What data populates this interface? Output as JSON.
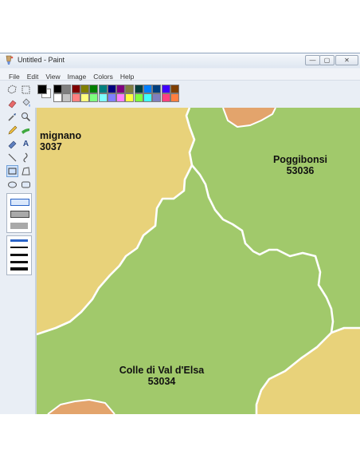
{
  "window": {
    "title": "Untitled - Paint",
    "controls": {
      "minimize": "—",
      "maximize": "▢",
      "close": "✕"
    }
  },
  "menu": {
    "items": [
      "File",
      "Edit",
      "View",
      "Image",
      "Colors",
      "Help"
    ]
  },
  "toolbox": {
    "tools": [
      "free-select-icon",
      "rect-select-icon",
      "eraser-icon",
      "fill-bucket-icon",
      "color-picker-icon",
      "magnifier-icon",
      "pencil-icon",
      "brush-icon",
      "airbrush-icon",
      "text-icon",
      "line-icon",
      "curve-icon",
      "rectangle-icon",
      "polygon-icon",
      "ellipse-icon",
      "rounded-rect-icon"
    ],
    "selected_tool": "rectangle-icon",
    "text_tool_glyph": "A"
  },
  "palette": {
    "foreground": "#000000",
    "background": "#ffffff",
    "colors": [
      "#000000",
      "#7f7f7f",
      "#7f0000",
      "#7f7f00",
      "#007f00",
      "#007f7f",
      "#00007f",
      "#7f007f",
      "#7f7f3f",
      "#003f3f",
      "#007fff",
      "#003f7f",
      "#3f00ff",
      "#7f3f00",
      "#ffffff",
      "#c3c3c3",
      "#ff7f7f",
      "#ffff7f",
      "#7fff7f",
      "#7fffff",
      "#7f7fff",
      "#ff7fff",
      "#ffff3f",
      "#7fff3f",
      "#3fffff",
      "#7f7fbf",
      "#ff3f7f",
      "#ff7f3f"
    ]
  },
  "map": {
    "colors": {
      "green": "#a1c96b",
      "yellow": "#e8d27a",
      "orange": "#e3a46c",
      "border": "#ffffff"
    },
    "regions": [
      {
        "name": "mignano",
        "code": "3037"
      },
      {
        "name": "Poggibonsi",
        "code": "53036"
      },
      {
        "name": "Colle di Val d'Elsa",
        "code": "53034"
      }
    ]
  }
}
